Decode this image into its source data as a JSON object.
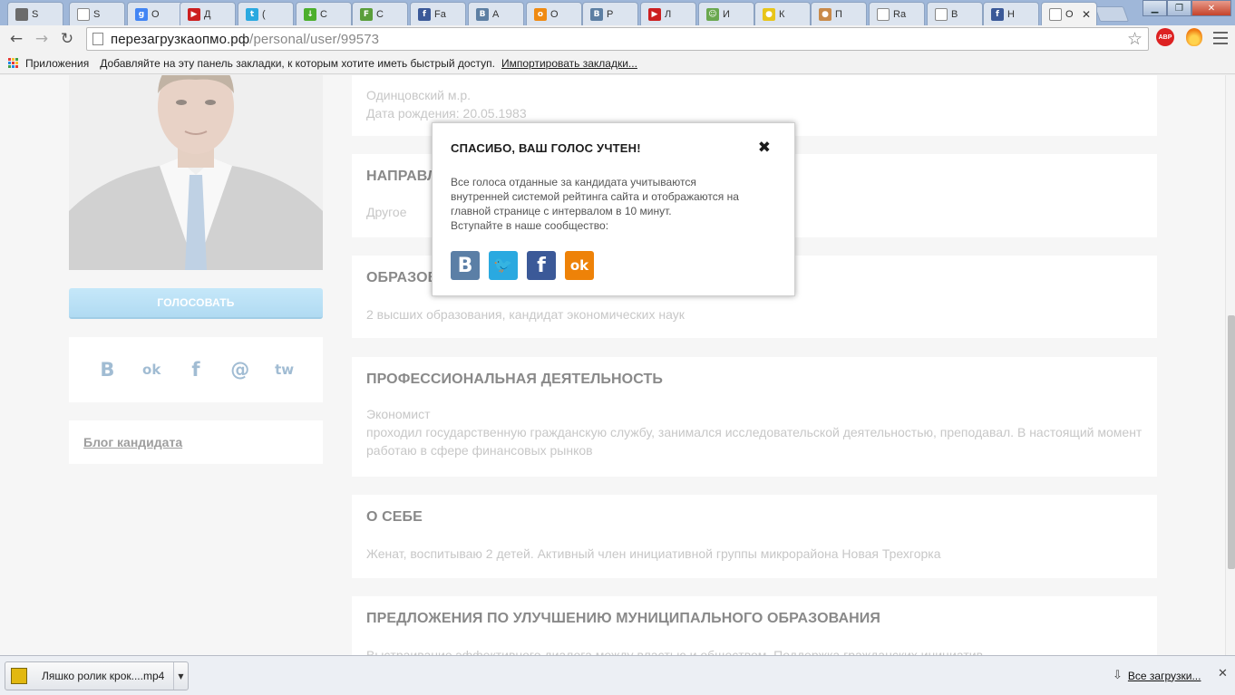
{
  "browser": {
    "tabs": [
      {
        "label": "S",
        "color": "#6b6b6b",
        "glyph": "",
        "icon": "chrome-icon"
      },
      {
        "label": "S",
        "color": "#ffffff",
        "glyph": "",
        "icon": "page-icon"
      },
      {
        "label": "О",
        "color": "#4285f4",
        "glyph": "g",
        "icon": "google-icon"
      },
      {
        "label": "Д",
        "color": "#cc1f1f",
        "glyph": "▶",
        "icon": "youtube-icon"
      },
      {
        "label": "(",
        "color": "#2aa9e0",
        "glyph": "t",
        "icon": "twitter-icon"
      },
      {
        "label": "С",
        "color": "#4caf2d",
        "glyph": "↓",
        "icon": "download-icon"
      },
      {
        "label": "С",
        "color": "#5a9e3a",
        "glyph": "F",
        "icon": "feedly-icon"
      },
      {
        "label": "Fa",
        "color": "#3b5998",
        "glyph": "f",
        "icon": "facebook-icon"
      },
      {
        "label": "А",
        "color": "#5d7fa3",
        "glyph": "В",
        "icon": "vk-icon"
      },
      {
        "label": "О",
        "color": "#ef8a12",
        "glyph": "о",
        "icon": "odnoklassniki-icon"
      },
      {
        "label": "Р",
        "color": "#5d7fa3",
        "glyph": "В",
        "icon": "vk-icon"
      },
      {
        "label": "Л",
        "color": "#cc1f1f",
        "glyph": "▶",
        "icon": "youtube-icon"
      },
      {
        "label": "И",
        "color": "#6aa84f",
        "glyph": "☺",
        "icon": "smiley-icon"
      },
      {
        "label": "К",
        "color": "#e8c51a",
        "glyph": "●",
        "icon": "coin-icon"
      },
      {
        "label": "П",
        "color": "#c98a4a",
        "glyph": "●",
        "icon": "avatar-icon"
      },
      {
        "label": "Ra",
        "color": "#ffffff",
        "glyph": "",
        "icon": "page-icon"
      },
      {
        "label": "В",
        "color": "#ffffff",
        "glyph": "",
        "icon": "page-icon"
      },
      {
        "label": "Н",
        "color": "#3b5998",
        "glyph": "f",
        "icon": "facebook-icon"
      },
      {
        "label": "О",
        "color": "#ffffff",
        "glyph": "",
        "icon": "page-icon",
        "active": true
      }
    ],
    "url_host": "перезагрузкаопмо.рф",
    "url_path": "/personal/user/99573",
    "abp_label": "ABP",
    "bookmarks": {
      "apps_label": "Приложения",
      "hint": "Добавляйте на эту панель закладки, к которым хотите иметь быстрый доступ.",
      "import_link": "Импортировать закладки..."
    }
  },
  "sidebar": {
    "vote_button": "ГОЛОСОВАТЬ",
    "share_icons": [
      {
        "glyph": "B",
        "name": "vk-share-icon"
      },
      {
        "glyph": "ok",
        "name": "odnoklassniki-share-icon"
      },
      {
        "glyph": "f",
        "name": "facebook-share-icon"
      },
      {
        "glyph": "@",
        "name": "mail-share-icon"
      },
      {
        "glyph": "tw",
        "name": "twitter-share-icon"
      }
    ],
    "blog_link": "Блог кандидата"
  },
  "profile": {
    "district": "Одинцовский м.р.",
    "birth": "Дата рождения: 20.05.1983",
    "direction_title": "НАПРАВЛ",
    "direction_value": "Другое",
    "education_title": "ОБРАЗОВ",
    "education_value": "2 высших образования, кандидат экономических наук",
    "professional_title": "ПРОФЕССИОНАЛЬНАЯ ДЕЯТЕЛЬНОСТЬ",
    "professional_role": "Экономист",
    "professional_text": "проходил государственную гражданскую службу, занимался исследовательской деятельностью, преподавал. В настоящий момент работаю в сфере финансовых рынков",
    "about_title": "О СЕБЕ",
    "about_text": "Женат, воспитываю 2 детей. Активный член инициативной группы микрорайона Новая Трехгорка",
    "proposals_title": "ПРЕДЛОЖЕНИЯ ПО УЛУЧШЕНИЮ МУНИЦИПАЛЬНОГО ОБРАЗОВАНИЯ",
    "proposals_text": "Выстраивание эффективного диалога между властью и обществом. Поддержка гражданских инициатив"
  },
  "modal": {
    "title": "СПАСИБО, ВАШ ГОЛОС УЧТЕН!",
    "close": "✖",
    "text_line1": "Все голоса отданные за кандидата учитываются",
    "text_line2": "внутренней системой рейтинга сайта и отображаются на",
    "text_line3": "главной странице с интервалом в 10 минут.",
    "text_line4": "Вступайте в наше сообщество:",
    "social": [
      {
        "glyph": "B",
        "color": "#5b7fa6",
        "name": "vk-social-icon"
      },
      {
        "glyph": "🐦",
        "color": "#2aa9e0",
        "name": "twitter-social-icon"
      },
      {
        "glyph": "f",
        "color": "#3b5998",
        "name": "facebook-social-icon"
      },
      {
        "glyph": "ok",
        "color": "#ee8208",
        "name": "odnoklassniki-social-icon"
      }
    ]
  },
  "downloads": {
    "file_name": "Ляшко ролик крок....mp4",
    "all_downloads": "Все загрузки..."
  }
}
